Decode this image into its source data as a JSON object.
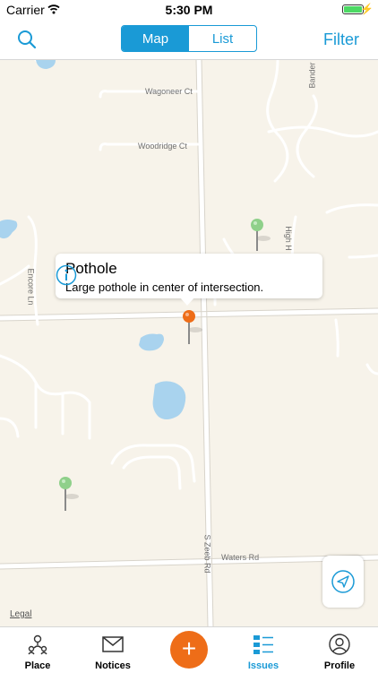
{
  "status_bar": {
    "carrier": "Carrier",
    "time": "5:30 PM"
  },
  "nav": {
    "segments": [
      "Map",
      "List"
    ],
    "active_segment": "Map",
    "filter_label": "Filter"
  },
  "map": {
    "streets": [
      "Wagoneer Ct",
      "Woodridge Ct",
      "Encore Ln",
      "High H",
      "Bander",
      "S Zeeb Rd",
      "Waters Rd"
    ],
    "legal": "Legal",
    "callout": {
      "title": "Pothole",
      "description": "Large pothole in center of intersection."
    }
  },
  "tabs": [
    {
      "label": "Place",
      "icon": "place-icon"
    },
    {
      "label": "Notices",
      "icon": "envelope-icon"
    },
    {
      "label": "",
      "icon": "add-icon"
    },
    {
      "label": "Issues",
      "icon": "issues-list-icon",
      "active": true
    },
    {
      "label": "Profile",
      "icon": "profile-icon"
    }
  ],
  "colors": {
    "accent": "#1a9ad6",
    "add_button": "#ee6d18",
    "pin_resolved": "#8fd08a",
    "pin_selected": "#ee6d18",
    "water": "#a9d3ee"
  }
}
